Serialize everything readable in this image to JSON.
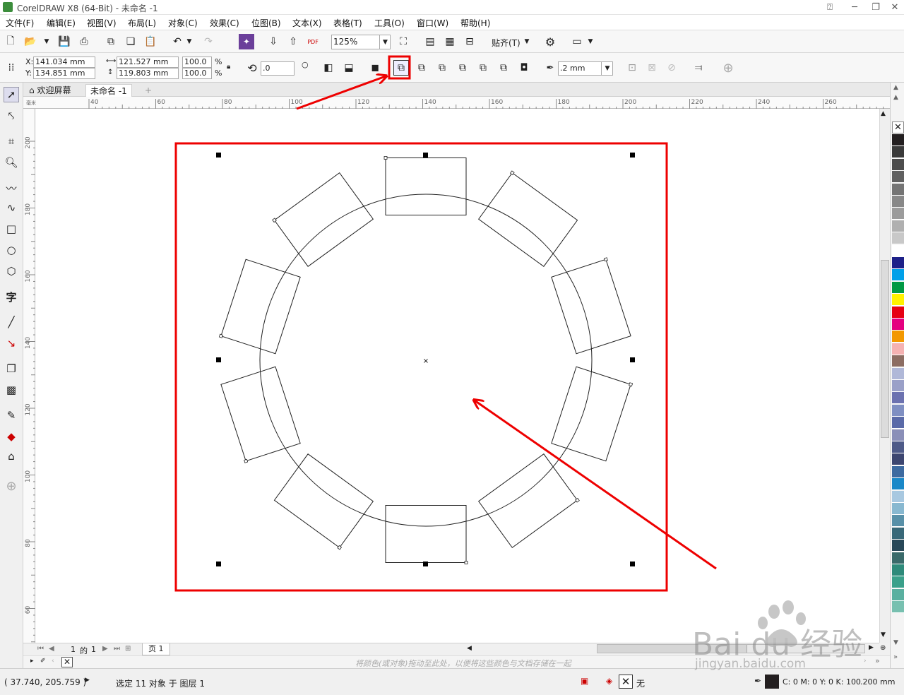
{
  "window": {
    "title": "CorelDRAW X8 (64-Bit) - 未命名 -1"
  },
  "menu": [
    "文件(F)",
    "编辑(E)",
    "视图(V)",
    "布局(L)",
    "对象(C)",
    "效果(C)",
    "位图(B)",
    "文本(X)",
    "表格(T)",
    "工具(O)",
    "窗口(W)",
    "帮助(H)"
  ],
  "toolbar": {
    "zoom": "125%",
    "snap_label": "贴齐(T)"
  },
  "properties": {
    "x_label": "X:",
    "x": "141.034 mm",
    "y_label": "Y:",
    "y": "134.851 mm",
    "width": "121.527 mm",
    "height": "119.803 mm",
    "scale_w": "100.0",
    "scale_h": "100.0",
    "pct": "%",
    "rotation": ".0",
    "outline_width": ".2 mm"
  },
  "tabs": {
    "welcome": "欢迎屏幕",
    "document": "未命名 -1"
  },
  "rulers": {
    "h_ticks": [
      "40",
      "60",
      "80",
      "100",
      "120",
      "140",
      "160",
      "180",
      "200",
      "220",
      "240",
      "260"
    ],
    "v_ticks": [
      "200",
      "180",
      "160",
      "140",
      "120",
      "100",
      "80",
      "60"
    ],
    "unit": "毫米"
  },
  "page_nav": {
    "current": "1",
    "of_label": "的",
    "total": "1",
    "page_tab": "页 1"
  },
  "doc_palette_hint": "将颜色(或对象)拖动至此处，以便将这些颜色与文档存储在一起",
  "status": {
    "coords": "( 37.740, 205.759 )",
    "selection": "选定 11 对象 于 图层 1",
    "fill_none": "无",
    "outline_color": "C: 0 M: 0 Y: 0 K: 100",
    "outline_width": ".200 mm"
  },
  "watermark": {
    "brand": "Bai du 经验",
    "url": "jingyan.baidu.com"
  },
  "palette_colors": [
    "#231f20",
    "#3a3a3a",
    "#4d4d4d",
    "#606060",
    "#747474",
    "#888888",
    "#9c9c9c",
    "#b0b0b0",
    "#c8c8c8",
    "#ffffff",
    "#1d2088",
    "#00a0e9",
    "#009944",
    "#fff100",
    "#e60012",
    "#e4007f",
    "#f39800",
    "#f5b2b2",
    "#8c6d62",
    "#b0b8d8",
    "#9aa0c8",
    "#6c72b0",
    "#7f8fc2",
    "#5a6aa8",
    "#8a8fb8",
    "#4e5a88",
    "#3d4670",
    "#3d6aa0",
    "#1a88c8",
    "#a8c8e0",
    "#88b8d0",
    "#5890a8",
    "#386878",
    "#284858",
    "#3a6a6a",
    "#2e8a7a",
    "#3aa08a",
    "#5ab0a0",
    "#78c0b0"
  ]
}
